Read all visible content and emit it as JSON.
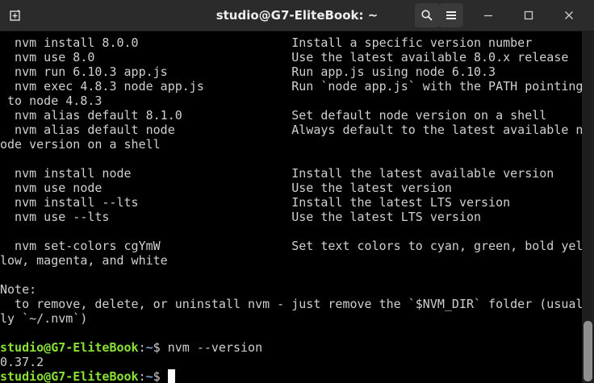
{
  "window": {
    "title": "studio@G7-EliteBook: ~"
  },
  "icons": {
    "new_tab": "new-tab-icon",
    "search": "search-icon",
    "menu": "hamburger-menu-icon",
    "minimize": "minimize-icon",
    "maximize": "maximize-icon",
    "close": "close-icon"
  },
  "colors": {
    "prompt_user": "#8ae234",
    "prompt_path": "#729fcf",
    "text": "#d0d0d0",
    "background": "#000000"
  },
  "terminal": {
    "lines": [
      "  nvm install 8.0.0                     Install a specific version number",
      "  nvm use 8.0                           Use the latest available 8.0.x release",
      "  nvm run 6.10.3 app.js                 Run app.js using node 6.10.3",
      "  nvm exec 4.8.3 node app.js            Run `node app.js` with the PATH pointing",
      " to node 4.8.3",
      "  nvm alias default 8.1.0               Set default node version on a shell",
      "  nvm alias default node                Always default to the latest available n",
      "ode version on a shell",
      "",
      "  nvm install node                      Install the latest available version",
      "  nvm use node                          Use the latest version",
      "  nvm install --lts                     Install the latest LTS version",
      "  nvm use --lts                         Use the latest LTS version",
      "",
      "  nvm set-colors cgYmW                  Set text colors to cyan, green, bold yel",
      "low, magenta, and white",
      "",
      "Note:",
      "  to remove, delete, or uninstall nvm - just remove the `$NVM_DIR` folder (usual",
      "ly `~/.nvm`)",
      ""
    ],
    "prompt1": {
      "user": "studio@G7-EliteBook",
      "sep": ":",
      "path": "~",
      "symbol": "$ ",
      "command": "nvm --version"
    },
    "output": "0.37.2",
    "prompt2": {
      "user": "studio@G7-EliteBook",
      "sep": ":",
      "path": "~",
      "symbol": "$ "
    }
  }
}
